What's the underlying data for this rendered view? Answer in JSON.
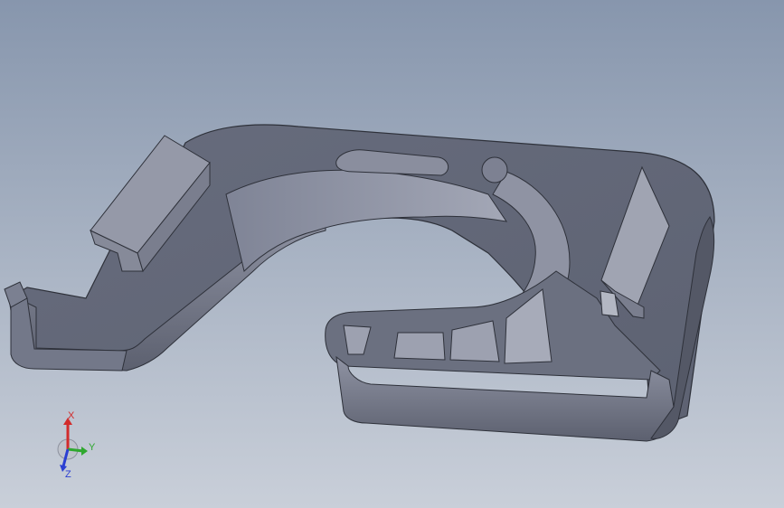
{
  "viewport": {
    "background_top": "#8796ad",
    "background_bottom": "#c9cfd9"
  },
  "model": {
    "face_top": "#6e7384",
    "face_side_light": "#8c90a0",
    "face_side_dark": "#5a5e6d",
    "edge": "#2e313a"
  },
  "triad": {
    "x_label": "X",
    "y_label": "Y",
    "z_label": "Z",
    "x_color": "#d22b2b",
    "y_color": "#2fa82f",
    "z_color": "#2b3fd2"
  }
}
